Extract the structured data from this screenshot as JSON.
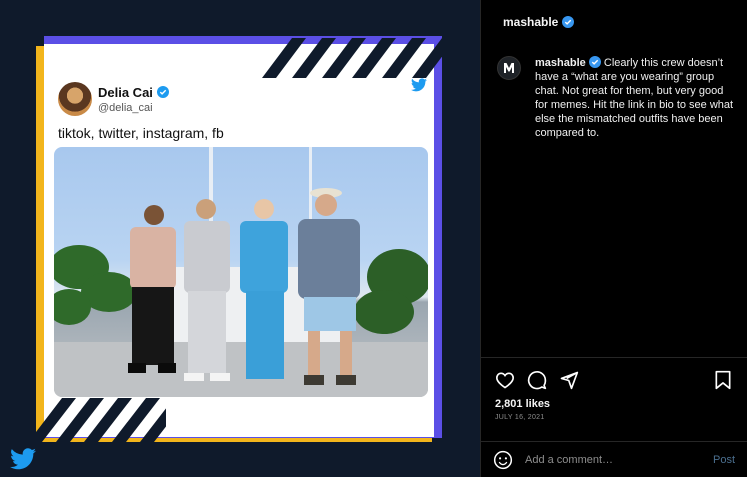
{
  "post": {
    "tweet": {
      "display_name": "Delia Cai",
      "handle": "@delia_cai",
      "text": "tiktok, twitter, instagram, fb"
    },
    "photo_icon": "people-photo",
    "brand_icon": "twitter-bird-icon"
  },
  "sidebar": {
    "header_username": "mashable",
    "caption_username": "mashable",
    "caption_text": "Clearly this crew doesn’t have a “what are you wearing” group chat. Not great for them, but very good for memes. Hit the link in bio to see what else the mismatched outfits have been compared to.",
    "likes": "2,801 likes",
    "date": "JULY 16, 2021",
    "comment_placeholder": "Add a comment…",
    "post_label": "Post"
  },
  "colors": {
    "twitter_blue": "#1d9bf0",
    "frame_yellow": "#f2b51c",
    "frame_purple": "#5b4fe6",
    "background_navy": "#0f1a2b"
  }
}
